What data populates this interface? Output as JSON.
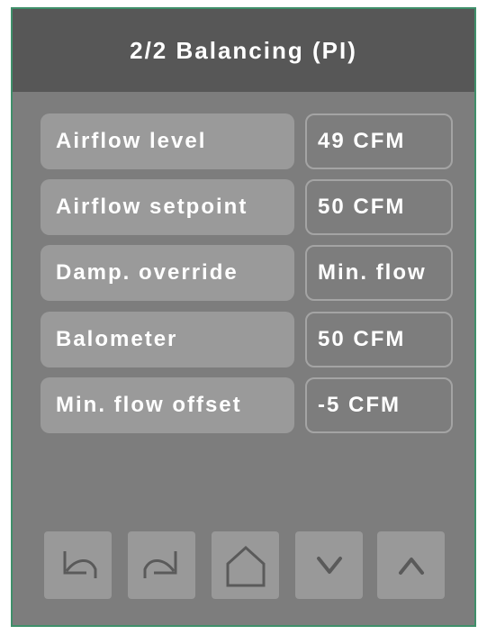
{
  "header": {
    "title": "2/2 Balancing (PI)"
  },
  "rows": [
    {
      "label": "Airflow level",
      "value": "49 CFM"
    },
    {
      "label": "Airflow setpoint",
      "value": "50 CFM"
    },
    {
      "label": "Damp. override",
      "value": "Min. flow"
    },
    {
      "label": "Balometer",
      "value": "50 CFM"
    },
    {
      "label": "Min. flow offset",
      "value": "-5 CFM"
    }
  ],
  "toolbar": {
    "buttons": [
      {
        "icon": "undo-icon"
      },
      {
        "icon": "redo-icon"
      },
      {
        "icon": "home-icon"
      },
      {
        "icon": "chevron-down-icon"
      },
      {
        "icon": "chevron-up-icon"
      }
    ]
  },
  "colors": {
    "panel": "#7d7d7d",
    "titlebar": "#575757",
    "label_bg": "#9a9a9a",
    "button_bg": "#999999",
    "icon": "#5a5a5a",
    "border_accent": "#3f8f6a",
    "text": "#ffffff"
  }
}
